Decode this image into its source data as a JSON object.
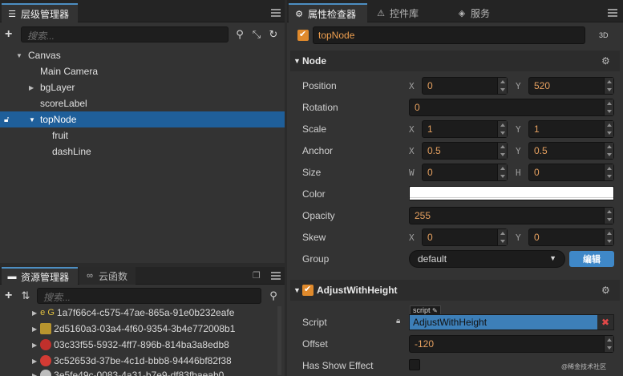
{
  "hierarchy": {
    "tab_label": "层级管理器",
    "search_placeholder": "搜索...",
    "nodes": [
      {
        "label": "Canvas",
        "expanded": true
      },
      {
        "label": "Main Camera"
      },
      {
        "label": "bgLayer",
        "expanded": false
      },
      {
        "label": "scoreLabel"
      },
      {
        "label": "topNode",
        "expanded": true,
        "selected": true
      },
      {
        "label": "fruit"
      },
      {
        "label": "dashLine"
      }
    ]
  },
  "assets": {
    "tab_label": "资源管理器",
    "tab2_label": "云函数",
    "search_placeholder": "搜索...",
    "items": [
      {
        "prefix": "e G",
        "label": "1a7f66c4-c575-47ae-865a-91e0b232eafe"
      },
      {
        "label": "2d5160a3-03a4-4f60-9354-3b4e772008b1"
      },
      {
        "label": "03c33f55-5932-4ff7-896b-814ba3a8edb8"
      },
      {
        "label": "3c52653d-37be-4c1d-bbb8-94446bf82f38"
      },
      {
        "label": "3e5fe49c-0083-4a31-b7e9-df83fbaeab0"
      }
    ]
  },
  "inspector": {
    "tabs": [
      "属性检查器",
      "控件库",
      "服务"
    ],
    "node_name": "topNode",
    "mode_label": "3D",
    "node_section": "Node",
    "props": {
      "position_label": "Position",
      "position_x": "0",
      "position_y": "520",
      "rotation_label": "Rotation",
      "rotation": "0",
      "scale_label": "Scale",
      "scale_x": "1",
      "scale_y": "1",
      "anchor_label": "Anchor",
      "anchor_x": "0.5",
      "anchor_y": "0.5",
      "size_label": "Size",
      "size_w": "0",
      "size_h": "0",
      "color_label": "Color",
      "color_value": "#ffffff",
      "opacity_label": "Opacity",
      "opacity": "255",
      "skew_label": "Skew",
      "skew_x": "0",
      "skew_y": "0",
      "group_label": "Group",
      "group_value": "default",
      "group_edit": "编辑"
    },
    "axis": {
      "x": "X",
      "y": "Y",
      "w": "W",
      "h": "H"
    },
    "component": {
      "title": "AdjustWithHeight",
      "script_tag": "script",
      "script_label": "Script",
      "script_value": "AdjustWithHeight",
      "offset_label": "Offset",
      "offset_value": "-120",
      "show_effect_label": "Has Show Effect"
    }
  },
  "watermark": "@稀金技术社区",
  "colors": {
    "accent": "#e08a2c",
    "selection": "#1f5f9a",
    "edit_button": "#3f88c8"
  }
}
